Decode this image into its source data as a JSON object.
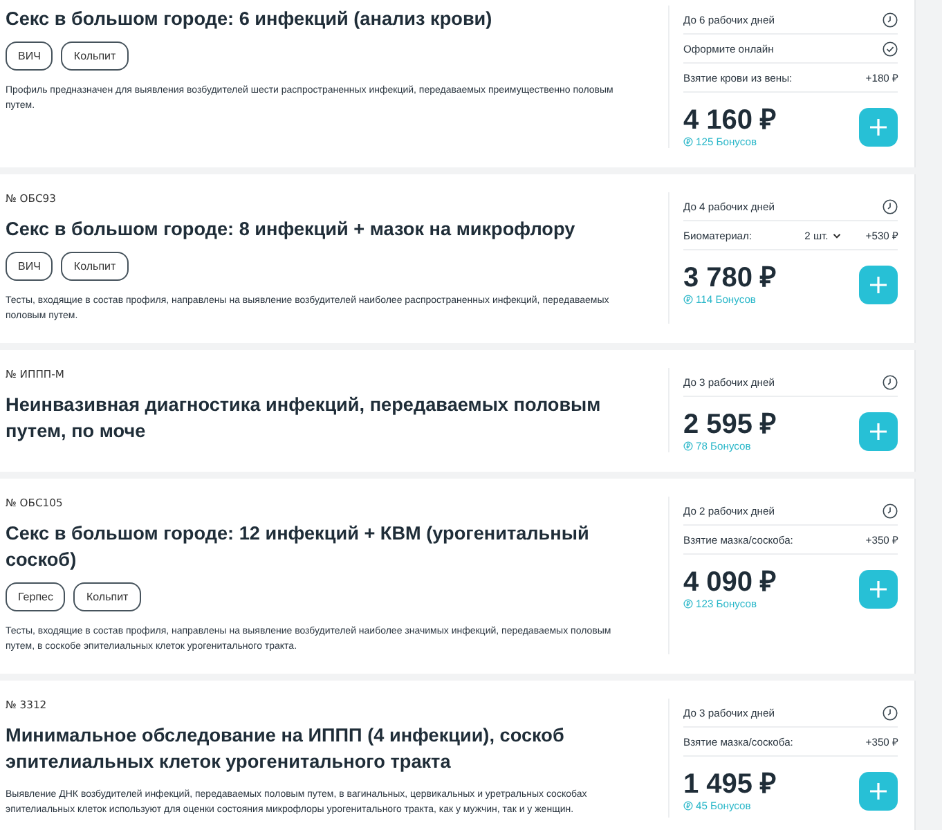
{
  "products": [
    {
      "title": "Секс в большом городе: 6 инфекций (анализ крови)",
      "tags": [
        "ВИЧ",
        "Кольпит"
      ],
      "description": "Профиль предназначен для выявления возбудителей шести распространенных инфекций, передаваемых преимущественно половым путем.",
      "details": [
        {
          "kind": "time",
          "label": "До 6 рабочих дней"
        },
        {
          "kind": "online",
          "label": "Оформите онлайн"
        },
        {
          "kind": "surcharge",
          "label": "Взятие крови из вены:",
          "price": "+180 ₽"
        }
      ],
      "price": "4 160 ₽",
      "bonus": "125 Бонусов"
    },
    {
      "code": "№ ОБС93",
      "title": "Секс в большом городе: 8 инфекций + мазок на микрофлору",
      "tags": [
        "ВИЧ",
        "Кольпит"
      ],
      "description": "Тесты, входящие в состав профиля, направлены на выявление возбудителей наиболее распространенных инфекций, передаваемых половым путем.",
      "details": [
        {
          "kind": "time",
          "label": "До 4 рабочих дней"
        },
        {
          "kind": "biomaterial",
          "label": "Биоматериал:",
          "value": "2 шт.",
          "price": "+530 ₽"
        }
      ],
      "price": "3 780 ₽",
      "bonus": "114 Бонусов"
    },
    {
      "code": "№ ИППП-М",
      "title": "Неинвазивная диагностика инфекций, передаваемых половым путем, по моче",
      "details": [
        {
          "kind": "time",
          "label": "До 3 рабочих дней"
        }
      ],
      "price": "2 595 ₽",
      "bonus": "78 Бонусов"
    },
    {
      "code": "№ ОБС105",
      "title": "Секс в большом городе: 12 инфекций + КВМ (урогенитальный соскоб)",
      "tags": [
        "Герпес",
        "Кольпит"
      ],
      "description": "Тесты, входящие в состав профиля, направлены на выявление возбудителей наиболее значимых инфекций, передаваемых половым путем, в соскобе эпителиальных клеток урогенитального тракта.",
      "details": [
        {
          "kind": "time",
          "label": "До 2 рабочих дней"
        },
        {
          "kind": "surcharge",
          "label": "Взятие мазка/соскоба:",
          "price": "+350 ₽"
        }
      ],
      "price": "4 090 ₽",
      "bonus": "123 Бонусов"
    },
    {
      "code": "№ 3312",
      "title": "Минимальное обследование на ИППП (4 инфекции), соскоб эпителиальных клеток урогенитального тракта",
      "description": "Выявление ДНК возбудителей инфекций, передаваемых половым путем, в вагинальных, цервикальных и уретральных соскобах эпителиальных клеток используют для оценки состояния микрофлоры урогенитального тракта, как у мужчин, так и у женщин.",
      "details": [
        {
          "kind": "time",
          "label": "До 3 рабочих дней"
        },
        {
          "kind": "surcharge",
          "label": "Взятие мазка/соскоба:",
          "price": "+350 ₽"
        }
      ],
      "price": "1 495 ₽",
      "bonus": "45 Бонусов"
    }
  ]
}
